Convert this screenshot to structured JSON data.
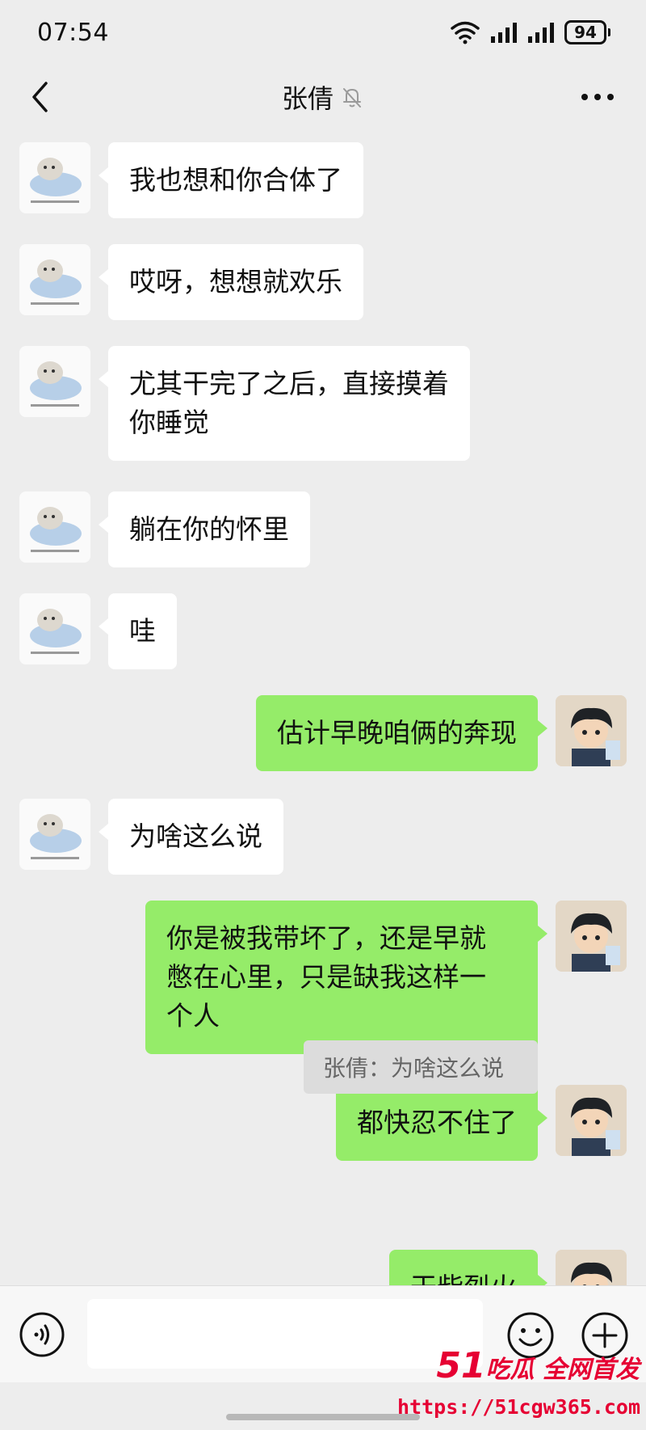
{
  "status_bar": {
    "time": "07:54",
    "battery": "94"
  },
  "header": {
    "title": "张倩",
    "back_icon": "chevron-left-icon",
    "mute_icon": "bell-off-icon",
    "more_icon": "more-dots-icon"
  },
  "messages": [
    {
      "side": "in",
      "lines": [
        "我也想和你合体了"
      ]
    },
    {
      "side": "in",
      "lines": [
        "哎呀，想想就欢乐"
      ]
    },
    {
      "side": "in",
      "lines": [
        "尤其干完了之后，直接摸着",
        "你睡觉"
      ]
    },
    {
      "side": "in",
      "lines": [
        "躺在你的怀里"
      ]
    },
    {
      "side": "in",
      "lines": [
        "哇"
      ]
    },
    {
      "side": "out",
      "lines": [
        "估计早晚咱俩的奔现"
      ]
    },
    {
      "side": "in",
      "lines": [
        "为啥这么说"
      ]
    },
    {
      "side": "out",
      "lines": [
        "你是被我带坏了，还是早就",
        "憋在心里，只是缺我这样一",
        "个人"
      ]
    },
    {
      "side": "out",
      "lines": [
        "都快忍不住了"
      ]
    },
    {
      "side": "out",
      "lines": [
        "干柴烈火"
      ]
    }
  ],
  "quote": {
    "text": "张倩：为啥这么说"
  },
  "input_bar": {
    "voice_icon": "voice-icon",
    "placeholder": "",
    "emoji_icon": "emoji-icon",
    "plus_icon": "plus-icon"
  },
  "watermark": {
    "line1_num": "51",
    "line1_text": "吃瓜 全网首发",
    "line2": "https://51cgw365.com"
  },
  "colors": {
    "background": "#ededed",
    "incoming_bubble": "#ffffff",
    "outgoing_bubble": "#95ec69",
    "watermark": "#e60033"
  }
}
